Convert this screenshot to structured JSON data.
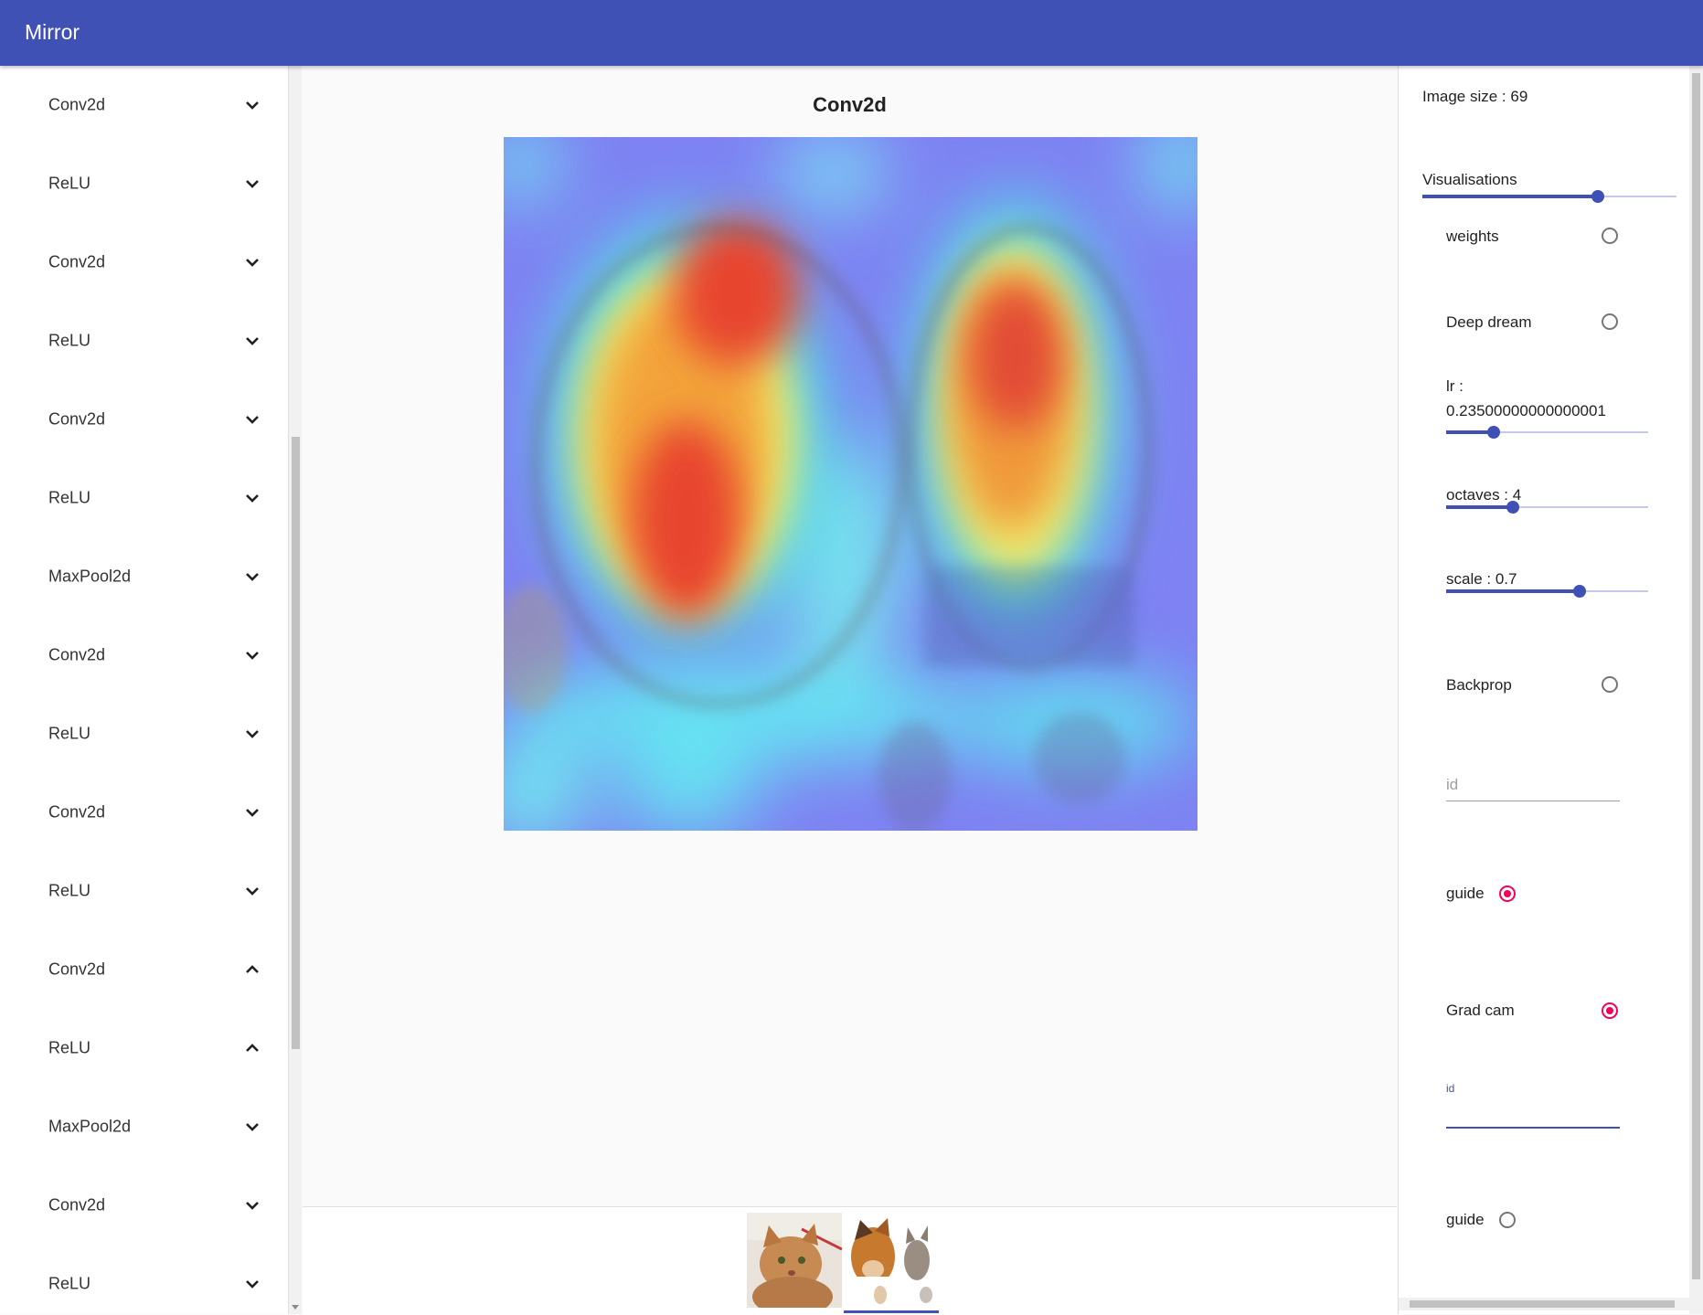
{
  "app": {
    "title": "Mirror"
  },
  "sidebar": {
    "layers": [
      {
        "label": "Conv2d",
        "expanded": false
      },
      {
        "label": "ReLU",
        "expanded": false
      },
      {
        "label": "Conv2d",
        "expanded": false
      },
      {
        "label": "ReLU",
        "expanded": false
      },
      {
        "label": "Conv2d",
        "expanded": false
      },
      {
        "label": "ReLU",
        "expanded": false
      },
      {
        "label": "MaxPool2d",
        "expanded": false
      },
      {
        "label": "Conv2d",
        "expanded": false
      },
      {
        "label": "ReLU",
        "expanded": false
      },
      {
        "label": "Conv2d",
        "expanded": false
      },
      {
        "label": "ReLU",
        "expanded": false
      },
      {
        "label": "Conv2d",
        "expanded": true
      },
      {
        "label": "ReLU",
        "expanded": true
      },
      {
        "label": "MaxPool2d",
        "expanded": false
      },
      {
        "label": "Conv2d",
        "expanded": false
      },
      {
        "label": "ReLU",
        "expanded": false
      }
    ]
  },
  "main": {
    "title": "Conv2d",
    "heatmap_name": "grad-cam-heatmap-dog-and-cat",
    "thumbnails": [
      {
        "name": "cat-thumbnail",
        "selected": false
      },
      {
        "name": "dog-and-cat-thumbnail",
        "selected": true
      }
    ]
  },
  "panel": {
    "image_size_label": "Image size : 69",
    "image_size_value": 0.69,
    "visualisations_label": "Visualisations",
    "weights_label": "weights",
    "weights_checked": false,
    "deep_dream_label": "Deep dream",
    "deep_dream_checked": false,
    "lr_label": "lr :",
    "lr_value_text": "0.23500000000000001",
    "lr_value": 0.235,
    "octaves_label": "octaves : 4",
    "octaves_value": 0.33,
    "scale_label": "scale : 0.7",
    "scale_value": 0.66,
    "backprop_label": "Backprop",
    "backprop_checked": false,
    "backprop_id_placeholder": "id",
    "backprop_guide_label": "guide",
    "backprop_guide_checked": true,
    "gradcam_label": "Grad cam",
    "gradcam_checked": true,
    "gradcam_id_label": "id",
    "gradcam_guide_label": "guide",
    "gradcam_guide_checked": false
  },
  "colors": {
    "primary": "#3f51b5",
    "accent": "#f50057"
  }
}
